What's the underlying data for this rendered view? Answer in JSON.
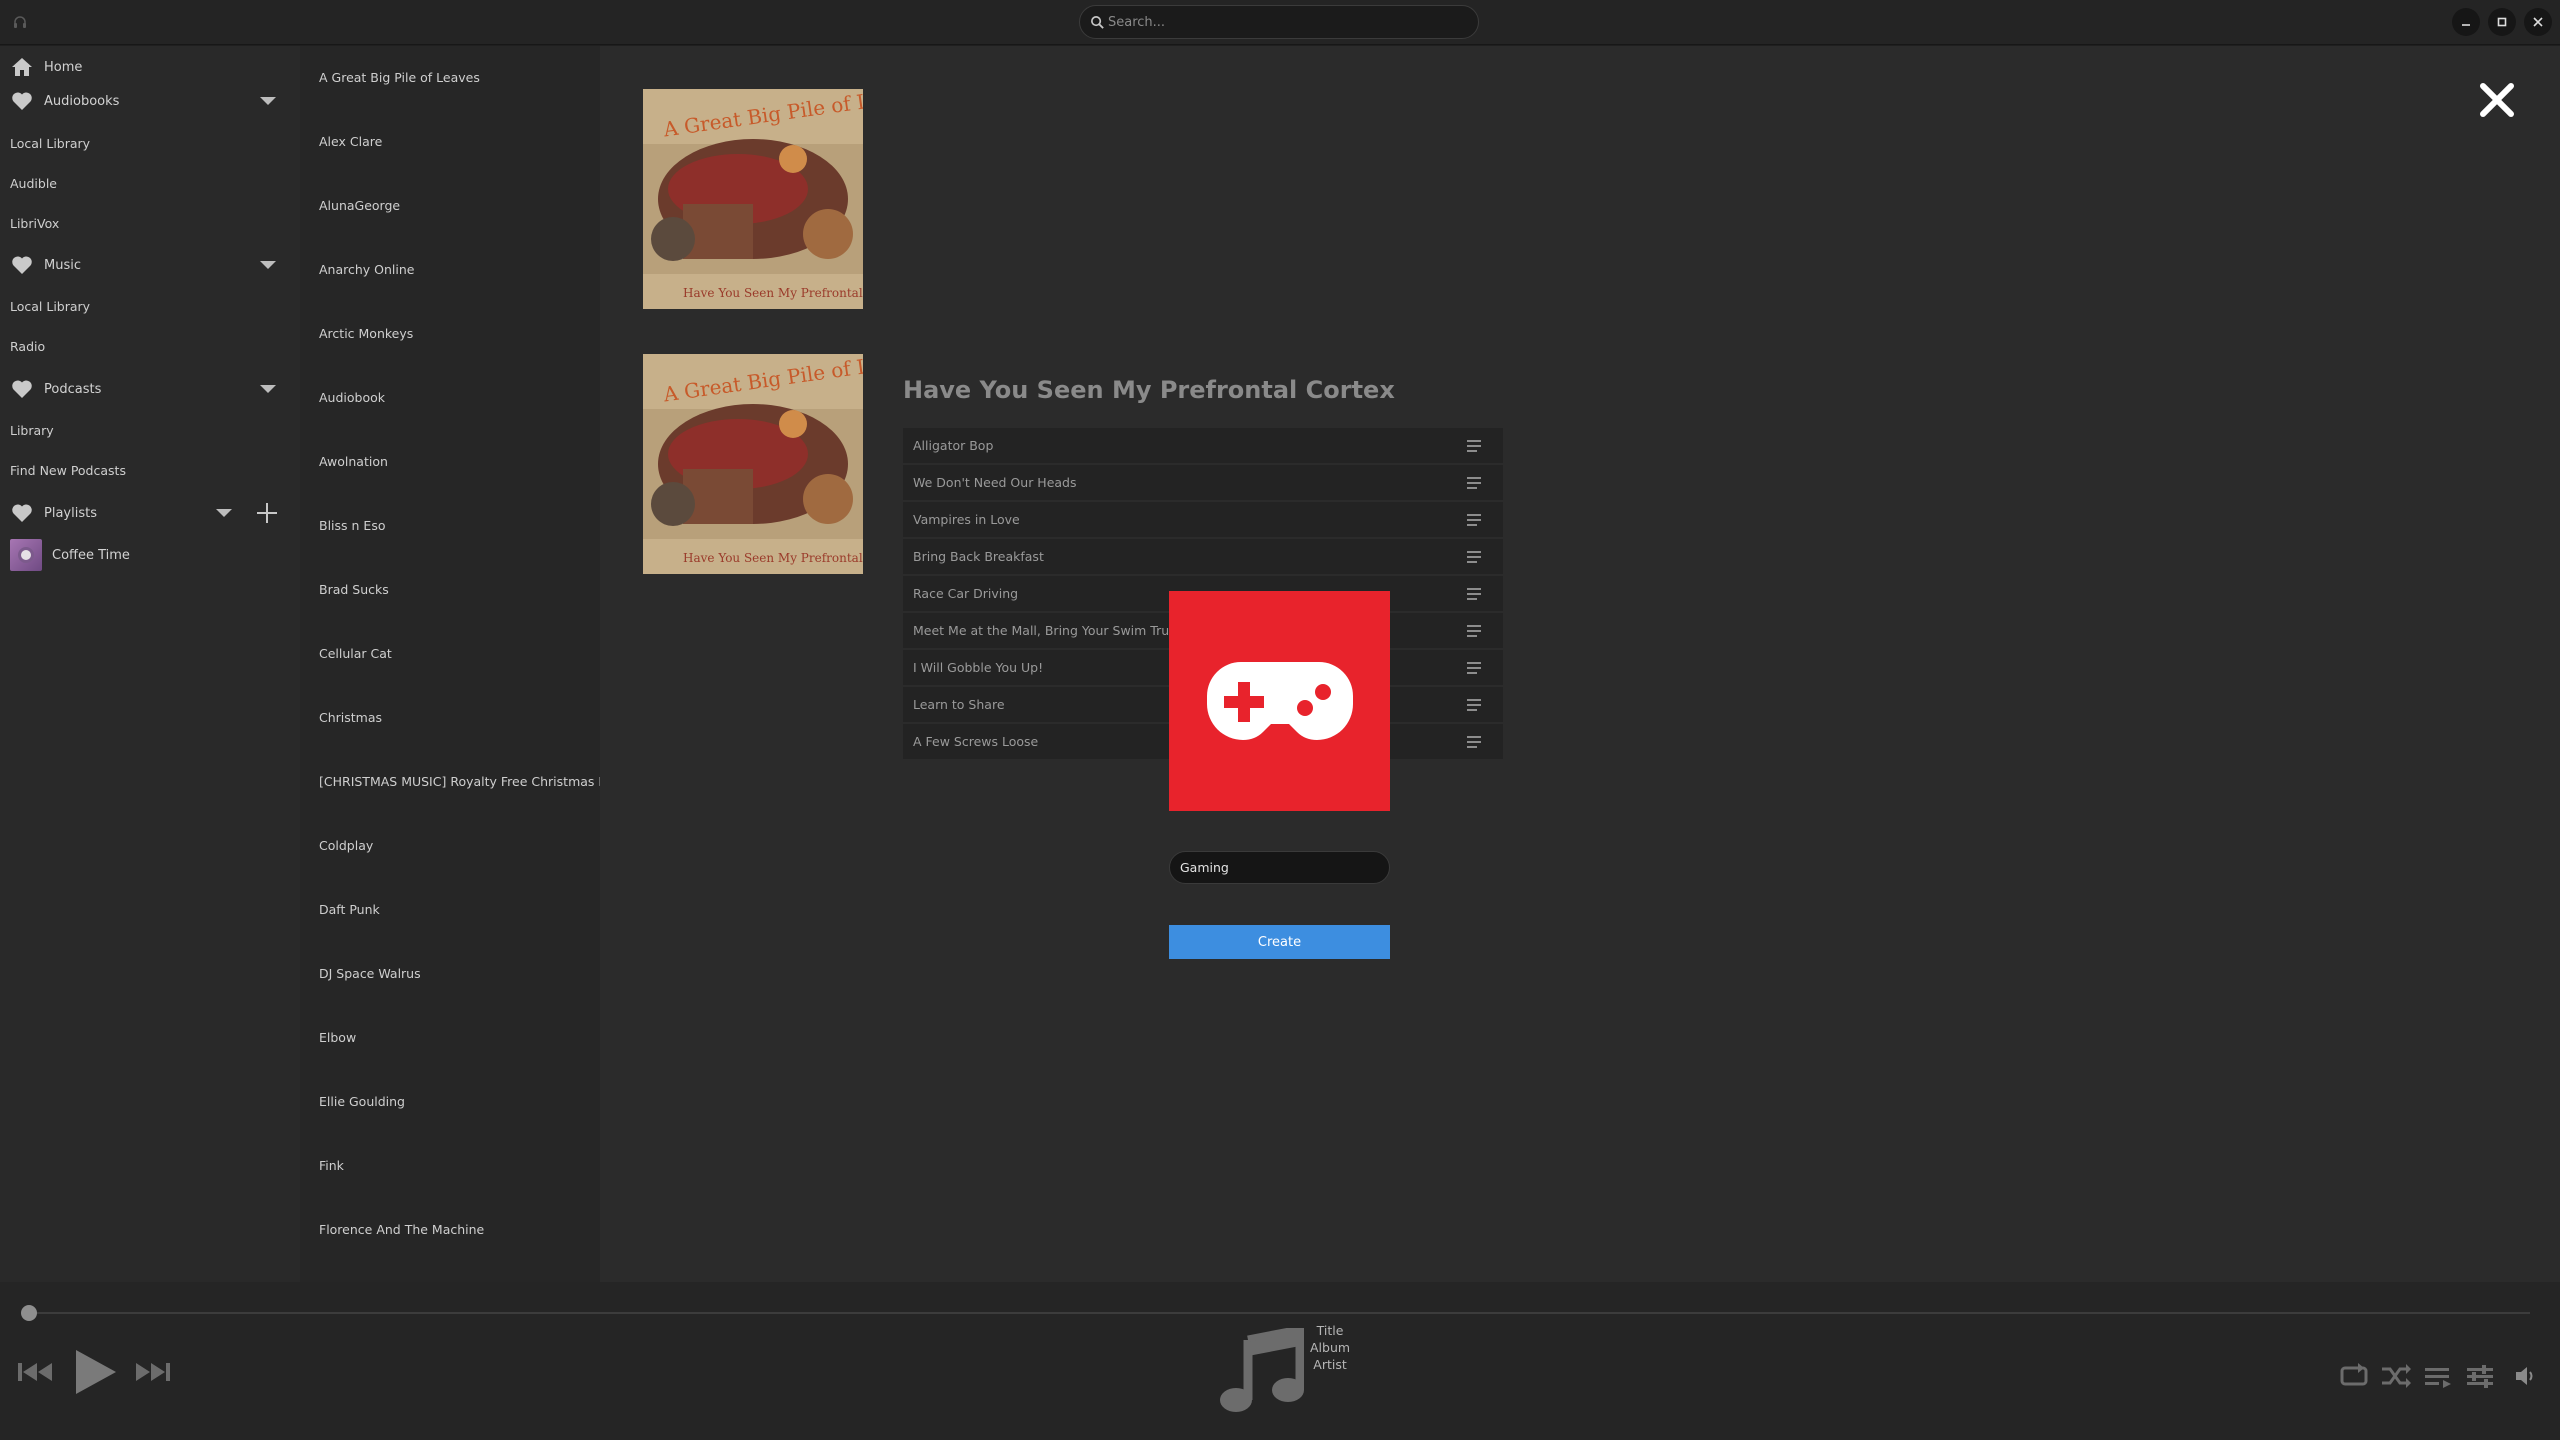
{
  "window": {
    "search_placeholder": "Search...",
    "buttons": [
      "minimize",
      "maximize",
      "close"
    ]
  },
  "sidebar": {
    "home_label": "Home",
    "sections": [
      {
        "label": "Audiobooks",
        "items": [
          "Local Library",
          "Audible",
          "LibriVox"
        ]
      },
      {
        "label": "Music",
        "items": [
          "Local Library",
          "Radio"
        ]
      },
      {
        "label": "Podcasts",
        "items": [
          "Library",
          "Find New Podcasts"
        ]
      },
      {
        "label": "Playlists",
        "items": [
          "Coffee Time"
        ]
      }
    ]
  },
  "artists": [
    "A Great Big Pile of Leaves",
    "Alex Clare",
    "AlunaGeorge",
    "Anarchy Online",
    "Arctic Monkeys",
    "Audiobook",
    "Awolnation",
    "Bliss n Eso",
    "Brad Sucks",
    "Cellular Cat",
    "Christmas",
    "[CHRISTMAS MUSIC] Royalty Free Christmas Music",
    "Coldplay",
    "Daft Punk",
    "DJ Space Walrus",
    "Elbow",
    "Ellie Goulding",
    "Fink",
    "Florence And The Machine"
  ],
  "album": {
    "title": "Have You Seen My Prefrontal Cortex",
    "tracks": [
      "Alligator Bop",
      "We Don't Need Our Heads",
      "Vampires in Love",
      "Bring Back Breakfast",
      "Race Car Driving",
      "Meet Me at the Mall, Bring Your Swim Trunks",
      "I Will Gobble You Up!",
      "Learn to Share",
      "A Few Screws Loose"
    ]
  },
  "create_playlist": {
    "name_value": "Gaming",
    "button_label": "Create",
    "art_icon": "gamepad-icon",
    "art_color": "#e8232c"
  },
  "player": {
    "title": "Title",
    "album": "Album",
    "artist": "Artist",
    "progress": 0
  },
  "colors": {
    "accent": "#3d8ee0",
    "background": "#2b2b2b"
  }
}
